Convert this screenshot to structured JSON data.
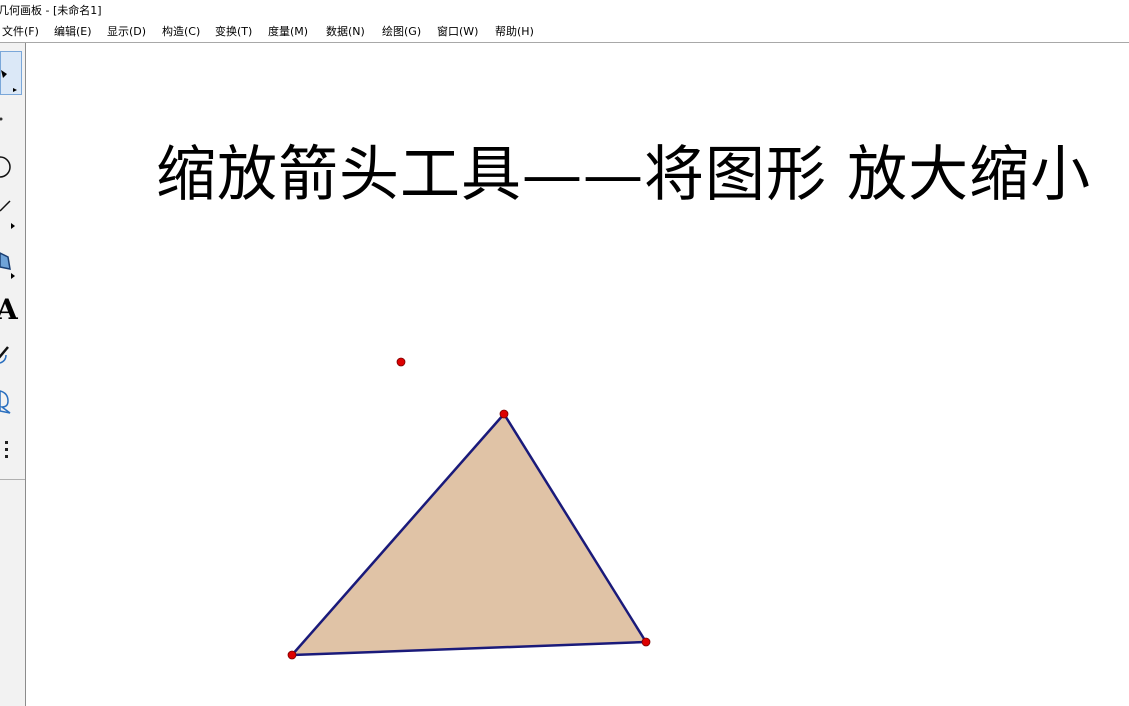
{
  "window": {
    "title": "几何画板 - [未命名1]"
  },
  "menu": {
    "items": [
      {
        "label": "文件(F)"
      },
      {
        "label": "编辑(E)"
      },
      {
        "label": "显示(D)"
      },
      {
        "label": "构造(C)"
      },
      {
        "label": "变换(T)"
      },
      {
        "label": "度量(M)"
      },
      {
        "label": "数据(N)"
      },
      {
        "label": "绘图(G)"
      },
      {
        "label": "窗口(W)"
      },
      {
        "label": "帮助(H)"
      }
    ]
  },
  "toolbar": {
    "tools": [
      {
        "name": "arrow-select-tool",
        "icon": "arrow-icon",
        "selected": true
      },
      {
        "name": "point-tool",
        "icon": "point-icon"
      },
      {
        "name": "compass-tool",
        "icon": "circle-icon"
      },
      {
        "name": "straightedge-tool",
        "icon": "line-segment-icon"
      },
      {
        "name": "polygon-tool",
        "icon": "polygon-icon"
      },
      {
        "name": "text-tool",
        "icon": "text-a-icon"
      },
      {
        "name": "marker-tool",
        "icon": "pencil-icon"
      },
      {
        "name": "information-tool",
        "icon": "speech-bubble-icon"
      },
      {
        "name": "custom-tool",
        "icon": "more-vertical-icon"
      }
    ]
  },
  "canvas": {
    "headline": "缩放箭头工具——将图形 放大缩小",
    "triangle_fill": "#e0c3a6",
    "triangle_stroke": "#1a1a7a",
    "point_color": "#dd0000"
  }
}
